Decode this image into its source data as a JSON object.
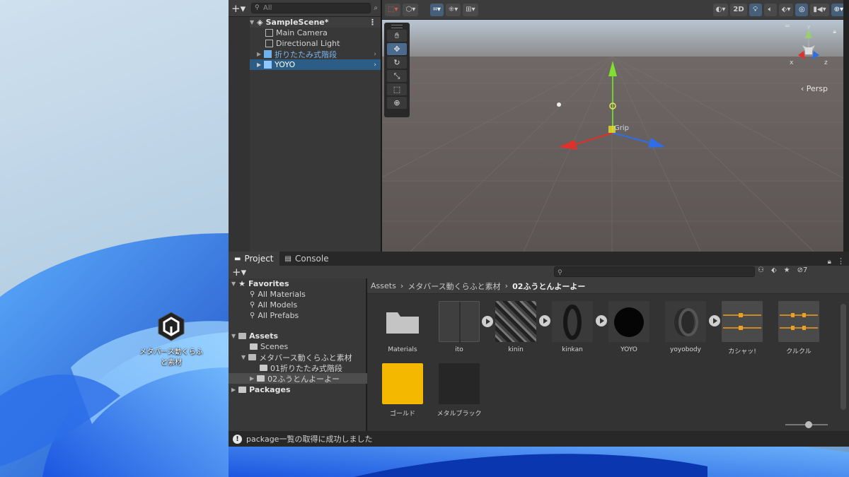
{
  "desktop": {
    "icon_label": "メタバース動くらふと素材"
  },
  "hierarchy": {
    "search_placeholder": "All",
    "scene": "SampleScene*",
    "items": [
      {
        "label": "Main Camera"
      },
      {
        "label": "Directional Light"
      },
      {
        "label": "折りたたみ式階段"
      },
      {
        "label": "YOYO"
      }
    ]
  },
  "scene_view": {
    "toolbar": {
      "mode_2d": "2D"
    },
    "camera_label": "Persp",
    "gizmo_label": "Grip",
    "axes": {
      "x": "x",
      "y": "y",
      "z": "z"
    }
  },
  "project": {
    "tabs": [
      "Project",
      "Console"
    ],
    "hidden_count": "7",
    "favorites": {
      "title": "Favorites",
      "items": [
        "All Materials",
        "All Models",
        "All Prefabs"
      ]
    },
    "assets": {
      "title": "Assets",
      "items": [
        "Scenes",
        "メタバース動くらふと素材",
        "01折りたたみ式階段",
        "02ふうとんよーよー"
      ]
    },
    "packages": "Packages",
    "breadcrumb": [
      "Assets",
      "メタバース動くらふと素材",
      "02ふうとんよーよー"
    ],
    "files": [
      {
        "name": "Materials"
      },
      {
        "name": "ito"
      },
      {
        "name": "kinin"
      },
      {
        "name": "kinkan"
      },
      {
        "name": "YOYO"
      },
      {
        "name": "yoyobody"
      },
      {
        "name": "カシャッ!"
      },
      {
        "name": "クルクル"
      },
      {
        "name": "ゴールド"
      },
      {
        "name": "メタルブラック"
      }
    ]
  },
  "status": {
    "message": "package一覧の取得に成功しました"
  },
  "colors": {
    "gold": "#F5B800",
    "selection": "#2C5D87",
    "editor_bg": "#383838"
  }
}
